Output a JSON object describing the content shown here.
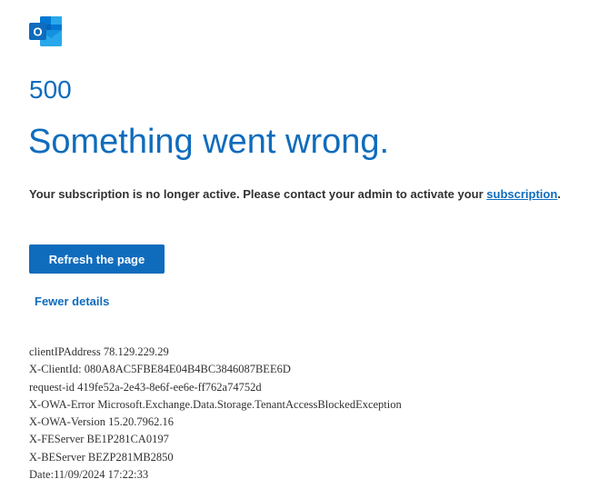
{
  "logo": {
    "icon": "outlook-logo-icon",
    "letter": "O",
    "colors": {
      "primary": "#0364b8",
      "light": "#28a8ea",
      "mid": "#0078d4",
      "badge": "#0f6cbd"
    }
  },
  "error": {
    "code": "500",
    "headline": "Something went wrong.",
    "message_before": "Your subscription is no longer active. Please contact your admin to activate your ",
    "message_link": "subscription",
    "message_after": "."
  },
  "actions": {
    "refresh_label": "Refresh the page",
    "details_toggle_label": "Fewer details"
  },
  "details": [
    "clientIPAddress 78.129.229.29",
    "X-ClientId: 080A8AC5FBE84E04B4BC3846087BEE6D",
    "request-id 419fe52a-2e43-8e6f-ee6e-ff762a74752d",
    "X-OWA-Error Microsoft.Exchange.Data.Storage.TenantAccessBlockedException",
    "X-OWA-Version 15.20.7962.16",
    "X-FEServer BE1P281CA0197",
    "X-BEServer BEZP281MB2850",
    "Date:11/09/2024 17:22:33"
  ],
  "theme": {
    "accent": "#0f6cbd",
    "text": "#323130",
    "background": "#ffffff"
  }
}
